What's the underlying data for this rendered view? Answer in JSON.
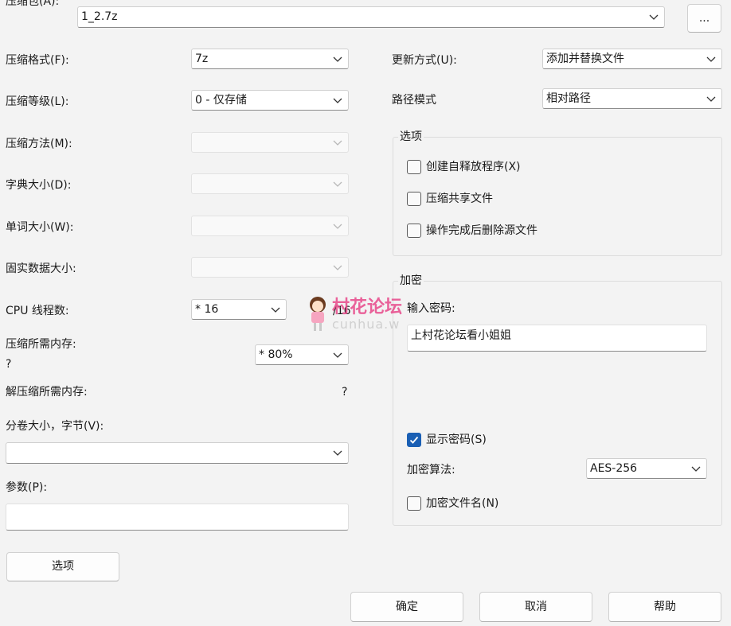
{
  "archive": {
    "label": "压缩包(A):",
    "value": "1_2.7z",
    "browse": "..."
  },
  "left": {
    "format": {
      "label": "压缩格式(F):",
      "value": "7z"
    },
    "level": {
      "label": "压缩等级(L):",
      "value": "0 - 仅存储"
    },
    "method": {
      "label": "压缩方法(M):",
      "value": ""
    },
    "dict": {
      "label": "字典大小(D):",
      "value": ""
    },
    "word": {
      "label": "单词大小(W):",
      "value": ""
    },
    "solid": {
      "label": "固实数据大小:",
      "value": ""
    },
    "cpu": {
      "label": "CPU 线程数:",
      "value": "*  16",
      "total": "/16"
    },
    "mem": {
      "label": "压缩所需内存:",
      "value_line": "?",
      "value": "* 80%"
    },
    "decomp": {
      "label": "解压缩所需内存:",
      "value": "?"
    },
    "volume": {
      "label": "分卷大小，字节(V):",
      "value": ""
    },
    "params": {
      "label": "参数(P):",
      "value": ""
    },
    "options_button": "选项"
  },
  "right": {
    "update": {
      "label": "更新方式(U):",
      "value": "添加并替换文件"
    },
    "path": {
      "label": "路径模式",
      "value": "相对路径"
    },
    "options": {
      "title": "选项",
      "items": [
        {
          "label": "创建自释放程序(X)",
          "checked": false
        },
        {
          "label": "压缩共享文件",
          "checked": false
        },
        {
          "label": "操作完成后删除源文件",
          "checked": false
        }
      ]
    },
    "encryption": {
      "title": "加密",
      "password_label": "输入密码:",
      "password_value": "上村花论坛看小姐姐",
      "show_password": {
        "label": "显示密码(S)",
        "checked": true
      },
      "algo_label": "加密算法:",
      "algo_value": "AES-256",
      "encrypt_names": {
        "label": "加密文件名(N)",
        "checked": false
      }
    }
  },
  "buttons": {
    "ok": "确定",
    "cancel": "取消",
    "help": "帮助"
  },
  "watermark": {
    "text": "村花论坛",
    "sub": "cunhua.w"
  },
  "colors": {
    "accent": "#1a5fb4",
    "watermark": "#e8488a",
    "background": "#f3f3f3"
  }
}
